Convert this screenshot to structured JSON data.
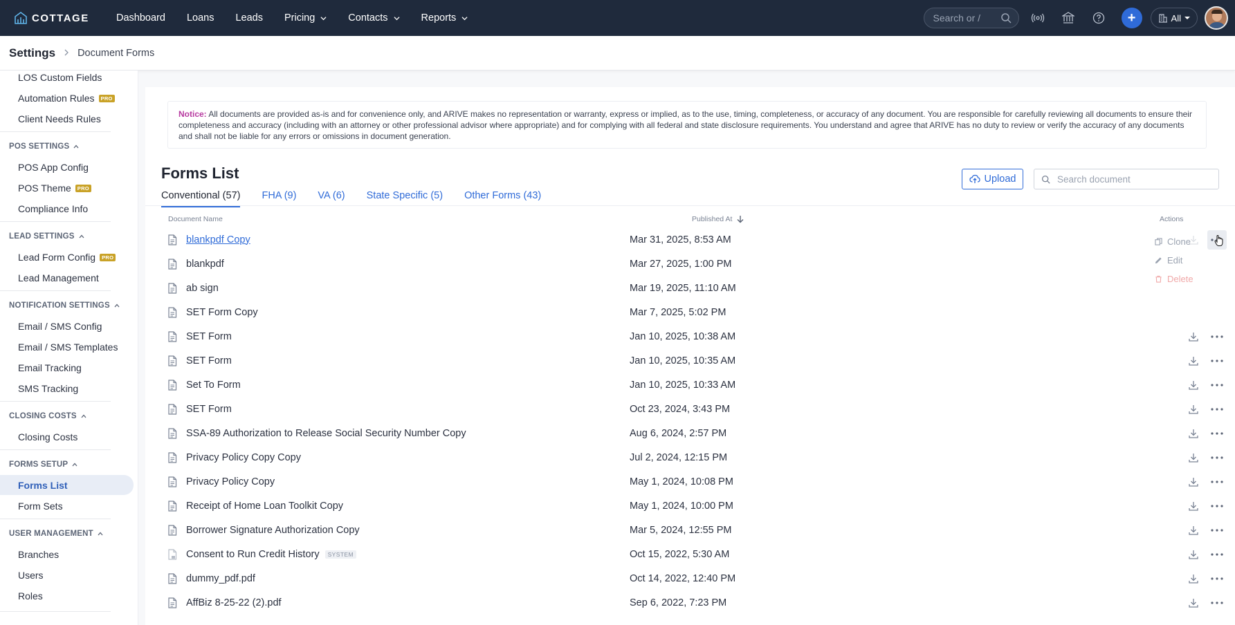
{
  "brand": {
    "name": "COTTAGE"
  },
  "nav": {
    "links": [
      "Dashboard",
      "Loans",
      "Leads",
      "Pricing",
      "Contacts",
      "Reports"
    ],
    "search_placeholder": "Search or /",
    "scope_label": "All"
  },
  "breadcrumb": {
    "section": "Settings",
    "page": "Document Forms"
  },
  "sidebar": {
    "items_top": [
      "LOS Custom Fields",
      "Automation Rules",
      "Client Needs Rules"
    ],
    "pos_settings": {
      "title": "POS SETTINGS",
      "items": [
        "POS App Config",
        "POS Theme",
        "Compliance Info"
      ]
    },
    "lead_settings": {
      "title": "LEAD SETTINGS",
      "items": [
        "Lead Form Config",
        "Lead Management"
      ]
    },
    "notification_settings": {
      "title": "NOTIFICATION SETTINGS",
      "items": [
        "Email / SMS Config",
        "Email / SMS Templates",
        "Email Tracking",
        "SMS Tracking"
      ]
    },
    "closing_costs": {
      "title": "CLOSING COSTS",
      "items": [
        "Closing Costs"
      ]
    },
    "forms_setup": {
      "title": "FORMS SETUP",
      "items": [
        "Forms List",
        "Form Sets"
      ]
    },
    "user_management": {
      "title": "USER MANAGEMENT",
      "items": [
        "Branches",
        "Users",
        "Roles"
      ]
    },
    "pro_badge": "PRO"
  },
  "notice": {
    "label": "Notice:",
    "text": "All documents are provided as-is and for convenience only, and ARIVE makes no representation or warranty, express or implied, as to the use, timing, completeness, or accuracy of any document. You are responsible for carefully reviewing all documents to ensure their completeness and accuracy (including with an attorney or other professional advisor where appropriate) and for complying with all federal and state disclosure requirements. You understand and agree that ARIVE has no duty to review or verify the accuracy of any documents and shall not be liable for any errors or omissions in document generation."
  },
  "forms": {
    "title": "Forms List",
    "tabs": [
      "Conventional (57)",
      "FHA (9)",
      "VA (6)",
      "State Specific (5)",
      "Other Forms (43)"
    ],
    "upload_label": "Upload",
    "search_placeholder": "Search document",
    "columns": {
      "name": "Document Name",
      "published": "Published At",
      "actions": "Actions"
    },
    "rows": [
      {
        "name": "blankpdf Copy",
        "date": "Mar 31, 2025, 8:53 AM"
      },
      {
        "name": "blankpdf",
        "date": "Mar 27, 2025, 1:00 PM"
      },
      {
        "name": "ab sign",
        "date": "Mar 19, 2025, 11:10 AM"
      },
      {
        "name": "SET Form Copy",
        "date": "Mar 7, 2025, 5:02 PM"
      },
      {
        "name": "SET Form",
        "date": "Jan 10, 2025, 10:38 AM"
      },
      {
        "name": "SET Form",
        "date": "Jan 10, 2025, 10:35 AM"
      },
      {
        "name": "Set To Form",
        "date": "Jan 10, 2025, 10:33 AM"
      },
      {
        "name": "SET Form",
        "date": "Oct 23, 2024, 3:43 PM"
      },
      {
        "name": "SSA-89 Authorization to Release Social Security Number Copy",
        "date": "Aug 6, 2024, 2:57 PM"
      },
      {
        "name": "Privacy Policy Copy Copy",
        "date": "Jul 2, 2024, 12:15 PM"
      },
      {
        "name": "Privacy Policy Copy",
        "date": "May 1, 2024, 10:08 PM"
      },
      {
        "name": "Receipt of Home Loan Toolkit Copy",
        "date": "May 1, 2024, 10:00 PM"
      },
      {
        "name": "Borrower Signature Authorization Copy",
        "date": "Mar 5, 2024, 12:55 PM"
      },
      {
        "name": "Consent to Run Credit History",
        "date": "Oct 15, 2022, 5:30 AM",
        "badge": "SYSTEM"
      },
      {
        "name": "dummy_pdf.pdf",
        "date": "Oct 14, 2022, 12:40 PM"
      },
      {
        "name": "AffBiz 8-25-22 (2).pdf",
        "date": "Sep 6, 2022, 7:23 PM"
      }
    ],
    "menu": [
      "Clone",
      "Edit",
      "Delete"
    ]
  }
}
